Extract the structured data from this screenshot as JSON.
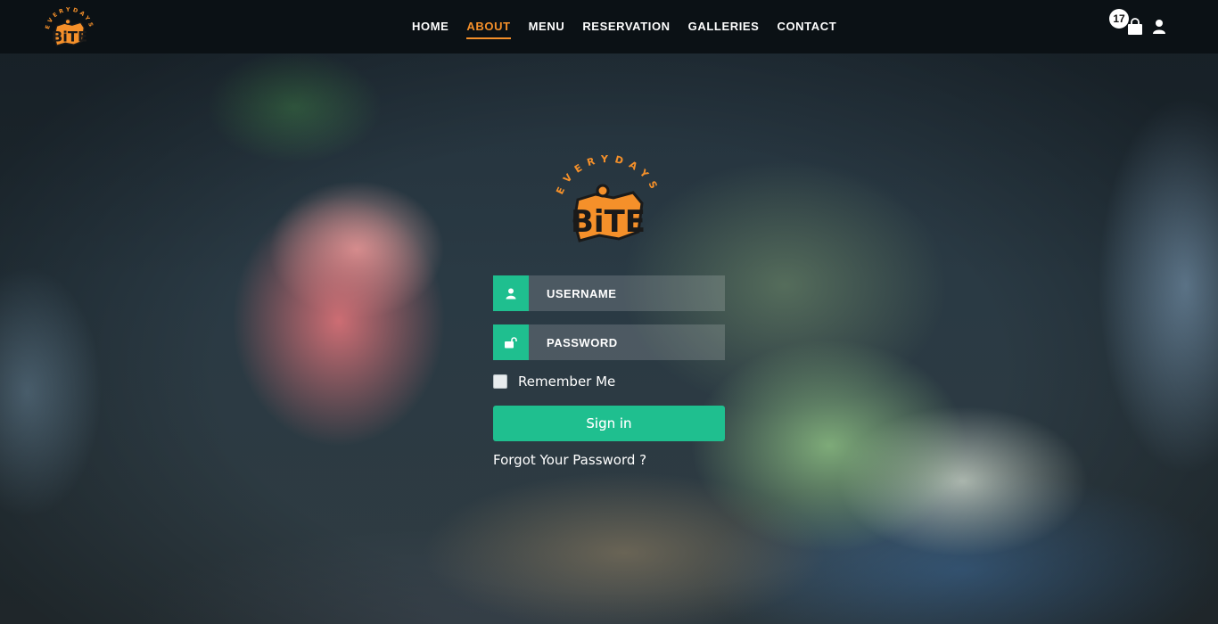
{
  "colors": {
    "accent_orange": "#f5902a",
    "accent_green": "#1fbf8f",
    "navbar_bg": "#0b1115"
  },
  "logo": {
    "arc_text": "EVERYDAYS",
    "word": "BiTE"
  },
  "nav": {
    "items": [
      {
        "label": "HOME",
        "active": false
      },
      {
        "label": "ABOUT",
        "active": true
      },
      {
        "label": "MENU",
        "active": false
      },
      {
        "label": "RESERVATION",
        "active": false
      },
      {
        "label": "GALLERIES",
        "active": false
      },
      {
        "label": "CONTACT",
        "active": false
      }
    ],
    "cart_count": "17",
    "icons": [
      "shopping-bag-icon",
      "user-icon"
    ]
  },
  "login": {
    "username_placeholder": "USERNAME",
    "password_placeholder": "PASSWORD",
    "username_icon": "user-icon",
    "password_icon": "unlock-icon",
    "remember_label": "Remember Me",
    "remember_checked": false,
    "signin_label": "Sign in",
    "forgot_label": "Forgot Your Password ?"
  }
}
